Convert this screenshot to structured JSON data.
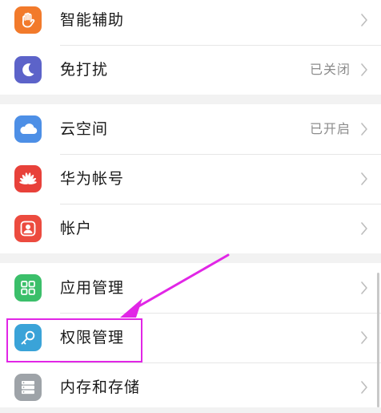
{
  "settings": {
    "items": [
      {
        "label": "智能辅助",
        "status": "",
        "icon": "hand-icon",
        "color": "#f27a2b"
      },
      {
        "label": "免打扰",
        "status": "已关闭",
        "icon": "moon-icon",
        "color": "#5c63c9"
      },
      {
        "label": "云空间",
        "status": "已开启",
        "icon": "cloud-icon",
        "color": "#4d8fe6"
      },
      {
        "label": "华为帐号",
        "status": "",
        "icon": "huawei-logo-icon",
        "color": "#e8413a"
      },
      {
        "label": "帐户",
        "status": "",
        "icon": "user-icon",
        "color": "#ec4b3f"
      },
      {
        "label": "应用管理",
        "status": "",
        "icon": "apps-grid-icon",
        "color": "#3bbf6a"
      },
      {
        "label": "权限管理",
        "status": "",
        "icon": "key-icon",
        "color": "#3aa3d8"
      },
      {
        "label": "内存和存储",
        "status": "",
        "icon": "storage-icon",
        "color": "#9ea3a8"
      }
    ]
  },
  "annotation": {
    "color": "#e126e6",
    "target": "权限管理"
  }
}
